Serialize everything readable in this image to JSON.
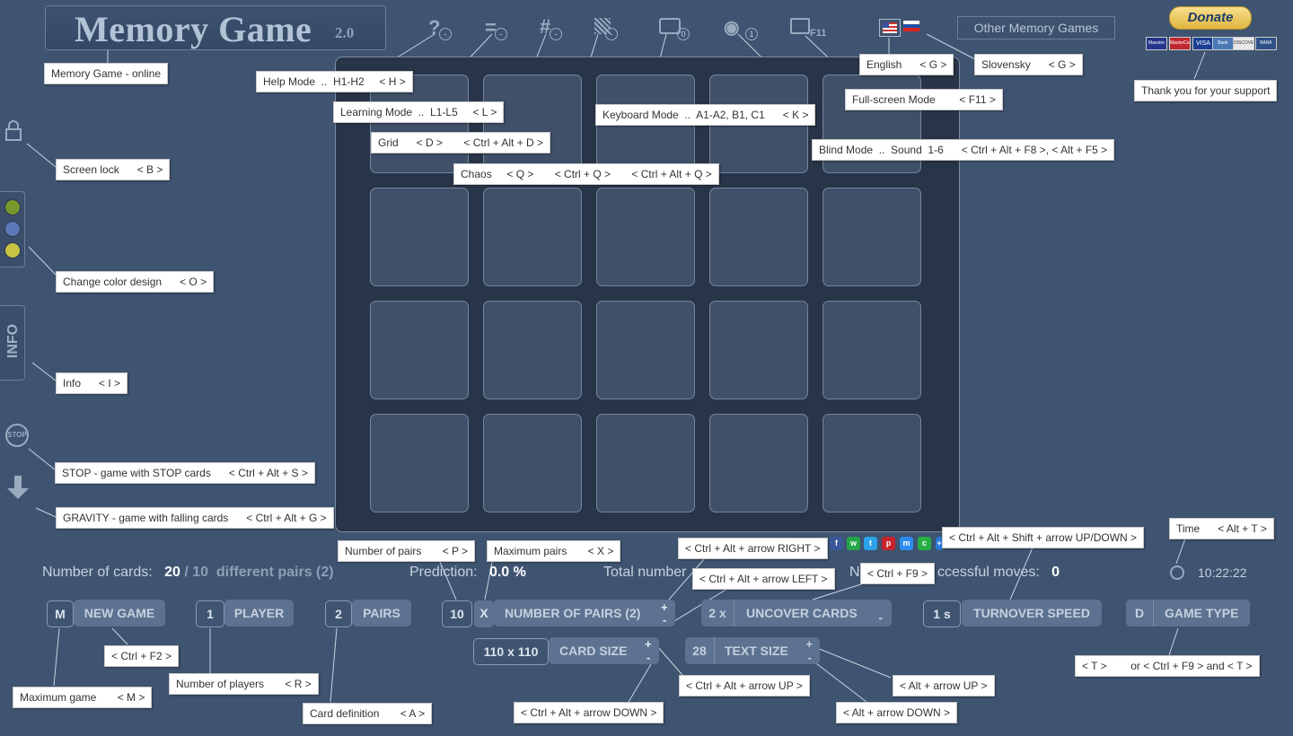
{
  "header": {
    "title": "Memory Game",
    "version": "2.0"
  },
  "top_icons": {
    "help": "?",
    "learning": "=",
    "grid": "#",
    "keyboard_count": "0",
    "blind_count": "1",
    "fullscreen_key": "F11"
  },
  "other_games_label": "Other Memory Games",
  "donate": {
    "label": "Donate",
    "cards": [
      "Maestro",
      "MasterCard",
      "VISA",
      "Bank",
      "DISCOVER",
      "BANK"
    ]
  },
  "side": {
    "info_label": "INFO",
    "stop_label": "STOP"
  },
  "tips": {
    "online": "Memory Game - online",
    "help": "Help Mode  ..  H1-H2     < H >",
    "learning": "Learning Mode  ..  L1-L5     < L >",
    "grid": "Grid      < D >       < Ctrl + Alt + D >",
    "chaos": "Chaos     < Q >       < Ctrl + Q >       < Ctrl + Alt + Q >",
    "keyboard": "Keyboard Mode  ..  A1-A2, B1, C1      < K >",
    "blind": "Blind Mode  ..  Sound  1-6      < Ctrl + Alt + F8 >, < Alt + F5 >",
    "fullscreen": "Full-screen Mode        < F11 >",
    "english": "English      < G >",
    "slovensky": "Slovensky      < G >",
    "support": "Thank you for your support",
    "screen_lock": "Screen lock      < B >",
    "color_design": "Change color design      < O >",
    "info": "Info      < I >",
    "stop": "STOP - game with STOP cards      < Ctrl + Alt + S >",
    "gravity": "GRAVITY - game with falling cards      < Ctrl + Alt + G >",
    "num_pairs": "Number of pairs       < P >",
    "max_pairs": "Maximum pairs       < X >",
    "arrow_right": "< Ctrl + Alt + arrow RIGHT >",
    "arrow_left": "< Ctrl + Alt + arrow LEFT >",
    "ctrl_f9": "< Ctrl + F9 >",
    "shift_updown": "< Ctrl + Alt + Shift + arrow UP/DOWN >",
    "time": "Time      < Alt + T >",
    "ctrl_f2": "< Ctrl + F2 >",
    "max_game": "Maximum game       < M >",
    "num_players": "Number of players       < R >",
    "card_def": "Card definition       < A >",
    "arrow_down": "< Ctrl + Alt + arrow DOWN >",
    "arrow_up": "< Ctrl + Alt + arrow UP >",
    "alt_up": "< Alt + arrow UP >",
    "alt_down": "< Alt + arrow DOWN >",
    "game_type": "< T >        or < Ctrl + F9 > and < T >"
  },
  "stats": {
    "cards_label": "Number of cards:",
    "cards_value": "20",
    "cards_sep": "/",
    "pairs_value": "10",
    "pairs_label": "different pairs (2)",
    "prediction_label": "Prediction:",
    "prediction_value": "0.0 %",
    "total_label": "Total number",
    "successful_a": "N",
    "successful_b": "ccessful moves:",
    "successful_value": "0",
    "time_value": "10:22:22"
  },
  "controls": {
    "max_game": "M",
    "new_game": "NEW GAME",
    "players_value": "1",
    "player": "PLAYER",
    "pairs_value": "2",
    "pairs": "PAIRS",
    "num_pairs_value": "10",
    "max_x": "X",
    "number_of_pairs": "NUMBER OF PAIRS (2)",
    "uncover_value": "2 x",
    "uncover": "UNCOVER CARDS",
    "turnover_value": "1 s",
    "turnover": "TURNOVER SPEED",
    "game_type_value": "D",
    "game_type": "GAME TYPE",
    "card_size_value": "110 x 110",
    "card_size": "CARD SIZE",
    "text_size_value": "28",
    "text_size": "TEXT SIZE",
    "plus": "+",
    "minus": "-"
  }
}
